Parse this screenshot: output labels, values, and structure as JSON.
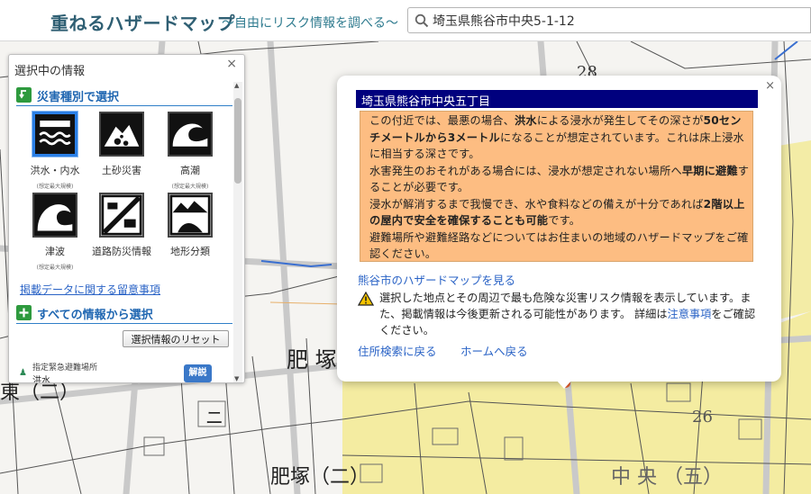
{
  "header": {
    "title": "重ねるハザードマップ",
    "subtitle": "～自由にリスク情報を調べる～",
    "search_value": "埼玉県熊谷市中央5-1-12",
    "search_icon": "search-icon"
  },
  "panel": {
    "title": "選択中の情報",
    "close": "×",
    "section1": "災害種別で選択",
    "hazards": [
      {
        "label": "洪水・内水",
        "note": "(想定最大規模)",
        "icon": "flood-icon",
        "selected": true
      },
      {
        "label": "土砂災害",
        "note": "",
        "icon": "landslide-icon",
        "selected": false
      },
      {
        "label": "高潮",
        "note": "(想定最大規模)",
        "icon": "storm-surge-icon",
        "selected": false
      },
      {
        "label": "津波",
        "note": "(想定最大規模)",
        "icon": "tsunami-icon",
        "selected": false
      },
      {
        "label": "道路防災情報",
        "note": "",
        "icon": "road-disaster-icon",
        "selected": false
      },
      {
        "label": "地形分類",
        "note": "",
        "icon": "terrain-icon",
        "selected": false
      }
    ],
    "notes_link": "掲載データに関する留意事項",
    "section2": "すべての情報から選択",
    "reset_button": "選択情報のリセット",
    "layer": {
      "name": "指定緊急避難場所",
      "sub": "洪水",
      "explain": "解説"
    },
    "scroll_up": "▲",
    "scroll_down": "▼"
  },
  "popup": {
    "close": "×",
    "title": "埼玉県熊谷市中央五丁目",
    "risk": [
      {
        "t": "この付近では、最悪の場合、"
      },
      {
        "t": "洪水",
        "b": true
      },
      {
        "t": "による浸水が発生してその深さが"
      },
      {
        "t": "50センチメートルから3メートル",
        "b": true
      },
      {
        "t": "になることが想定されています。これは床上浸水に相当する深さです。"
      },
      {
        "br": true
      },
      {
        "t": "水害発生のおそれがある場合には、浸水が想定されない場所へ"
      },
      {
        "t": "早期に避難",
        "b": true
      },
      {
        "t": "することが必要です。"
      },
      {
        "br": true
      },
      {
        "t": "浸水が解消するまで我慢でき、水や食料などの備えが十分であれば"
      },
      {
        "t": "2階以上の屋内で安全を確保することも可能",
        "b": true
      },
      {
        "t": "です。"
      },
      {
        "br": true
      },
      {
        "t": "避難場所や避難経路などについてはお住まいの地域のハザードマップをご確認ください。"
      }
    ],
    "city_link": "熊谷市のハザードマップを見る",
    "disclaimer_pre": "選択した地点とその周辺で最も危険な災害リスク情報を表示しています。また、掲載情報は今後更新される可能性があります。 詳細は",
    "caution_link": "注意事項",
    "disclaimer_post": "をご確認ください。",
    "back_address": "住所検索に戻る",
    "back_home": "ホームへ戻る",
    "warn_icon": "warning-icon"
  },
  "map": {
    "labels": [
      "肥 塚",
      "肥塚（二）",
      "中 央 （五）",
      "26",
      "28",
      "東（二）",
      "ニ"
    ],
    "highlight_color": "#f3ea93",
    "road_color": "#d8d8d8",
    "river_color": "#3a6fd0"
  },
  "colors": {
    "accent": "#1f66b1",
    "title_bar": "#00007e",
    "risk_bg": "#fdbd82",
    "link": "#2a63c6"
  }
}
